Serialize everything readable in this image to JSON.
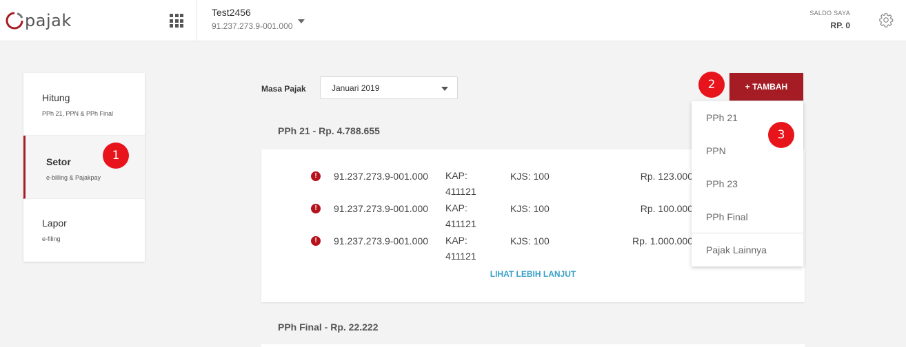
{
  "header": {
    "logo_text": "pajak",
    "account_name": "Test2456",
    "account_npwp": "91.237.273.9-001.000",
    "saldo_label": "SALDO SAYA",
    "saldo_value": "RP. 0"
  },
  "sidebar": {
    "items": [
      {
        "title": "Hitung",
        "sub": "PPh 21, PPN & PPh Final"
      },
      {
        "title": "Setor",
        "sub": "e-billing & Pajakpay"
      },
      {
        "title": "Lapor",
        "sub": "e-filing"
      }
    ]
  },
  "masa_pajak": {
    "label": "Masa Pajak",
    "value": "Januari 2019"
  },
  "tambah_label": "+ TAMBAH",
  "sections": [
    {
      "title": "PPh 21 - Rp. 4.788.655"
    },
    {
      "title": "PPh Final - Rp. 22.222"
    }
  ],
  "rows": [
    {
      "warn": "!",
      "npwp": "91.237.273.9-001.000",
      "kap": "KAP: 411121",
      "kjs": "KJS: 100",
      "amount": "Rp. 123.000"
    },
    {
      "warn": "!",
      "npwp": "91.237.273.9-001.000",
      "kap": "KAP: 411121",
      "kjs": "KJS: 100",
      "amount": "Rp. 100.000"
    },
    {
      "warn": "!",
      "npwp": "91.237.273.9-001.000",
      "kap": "KAP: 411121",
      "kjs": "KJS: 100",
      "amount": "Rp. 1.000.000"
    }
  ],
  "more_label": "LIHAT LEBIH LANJUT",
  "dropdown": {
    "items": [
      "PPh 21",
      "PPN",
      "PPh 23",
      "PPh Final",
      "Pajak Lainnya"
    ]
  },
  "badges": [
    "1",
    "2",
    "3"
  ],
  "colors": {
    "brand": "#a51c24",
    "badge": "#e8141c",
    "link": "#3aa0c8"
  },
  "icons": {
    "apps": "apps-grid-icon",
    "settings": "gear-icon",
    "warning": "alert-circle-icon"
  }
}
